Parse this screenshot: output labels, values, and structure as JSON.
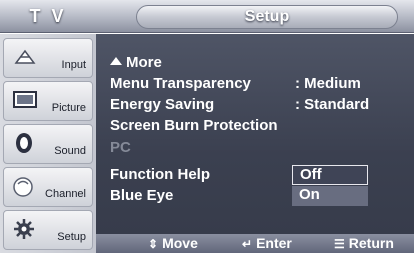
{
  "header": {
    "tv_title": "T V",
    "menu_title": "Setup"
  },
  "sidebar": {
    "items": [
      {
        "label": "Input",
        "icon": "input-icon"
      },
      {
        "label": "Picture",
        "icon": "picture-icon"
      },
      {
        "label": "Sound",
        "icon": "sound-icon"
      },
      {
        "label": "Channel",
        "icon": "channel-icon"
      },
      {
        "label": "Setup",
        "icon": "setup-icon"
      }
    ]
  },
  "menu": {
    "more_label": "More",
    "rows": [
      {
        "label": "Menu Transparency",
        "value": ": Medium"
      },
      {
        "label": "Energy Saving",
        "value": ": Standard"
      },
      {
        "label": "Screen Burn Protection",
        "value": ""
      },
      {
        "label": "PC",
        "value": ""
      },
      {
        "label": "Function Help",
        "value": ":"
      },
      {
        "label": "Blue Eye",
        "value": ":"
      }
    ],
    "options": {
      "off": "Off",
      "on": "On"
    }
  },
  "footer": {
    "move_label": "Move",
    "enter_label": "Enter",
    "return_label": "Return",
    "move_icon": "up-down-arrows-icon",
    "enter_icon": "enter-icon",
    "return_icon": "menu-return-icon"
  },
  "colors": {
    "panel_bg": "#3b4050",
    "header_bg": "#b4b8c4",
    "text": "#ffffff",
    "disabled_text": "#858a98",
    "highlight": "#686d80"
  }
}
